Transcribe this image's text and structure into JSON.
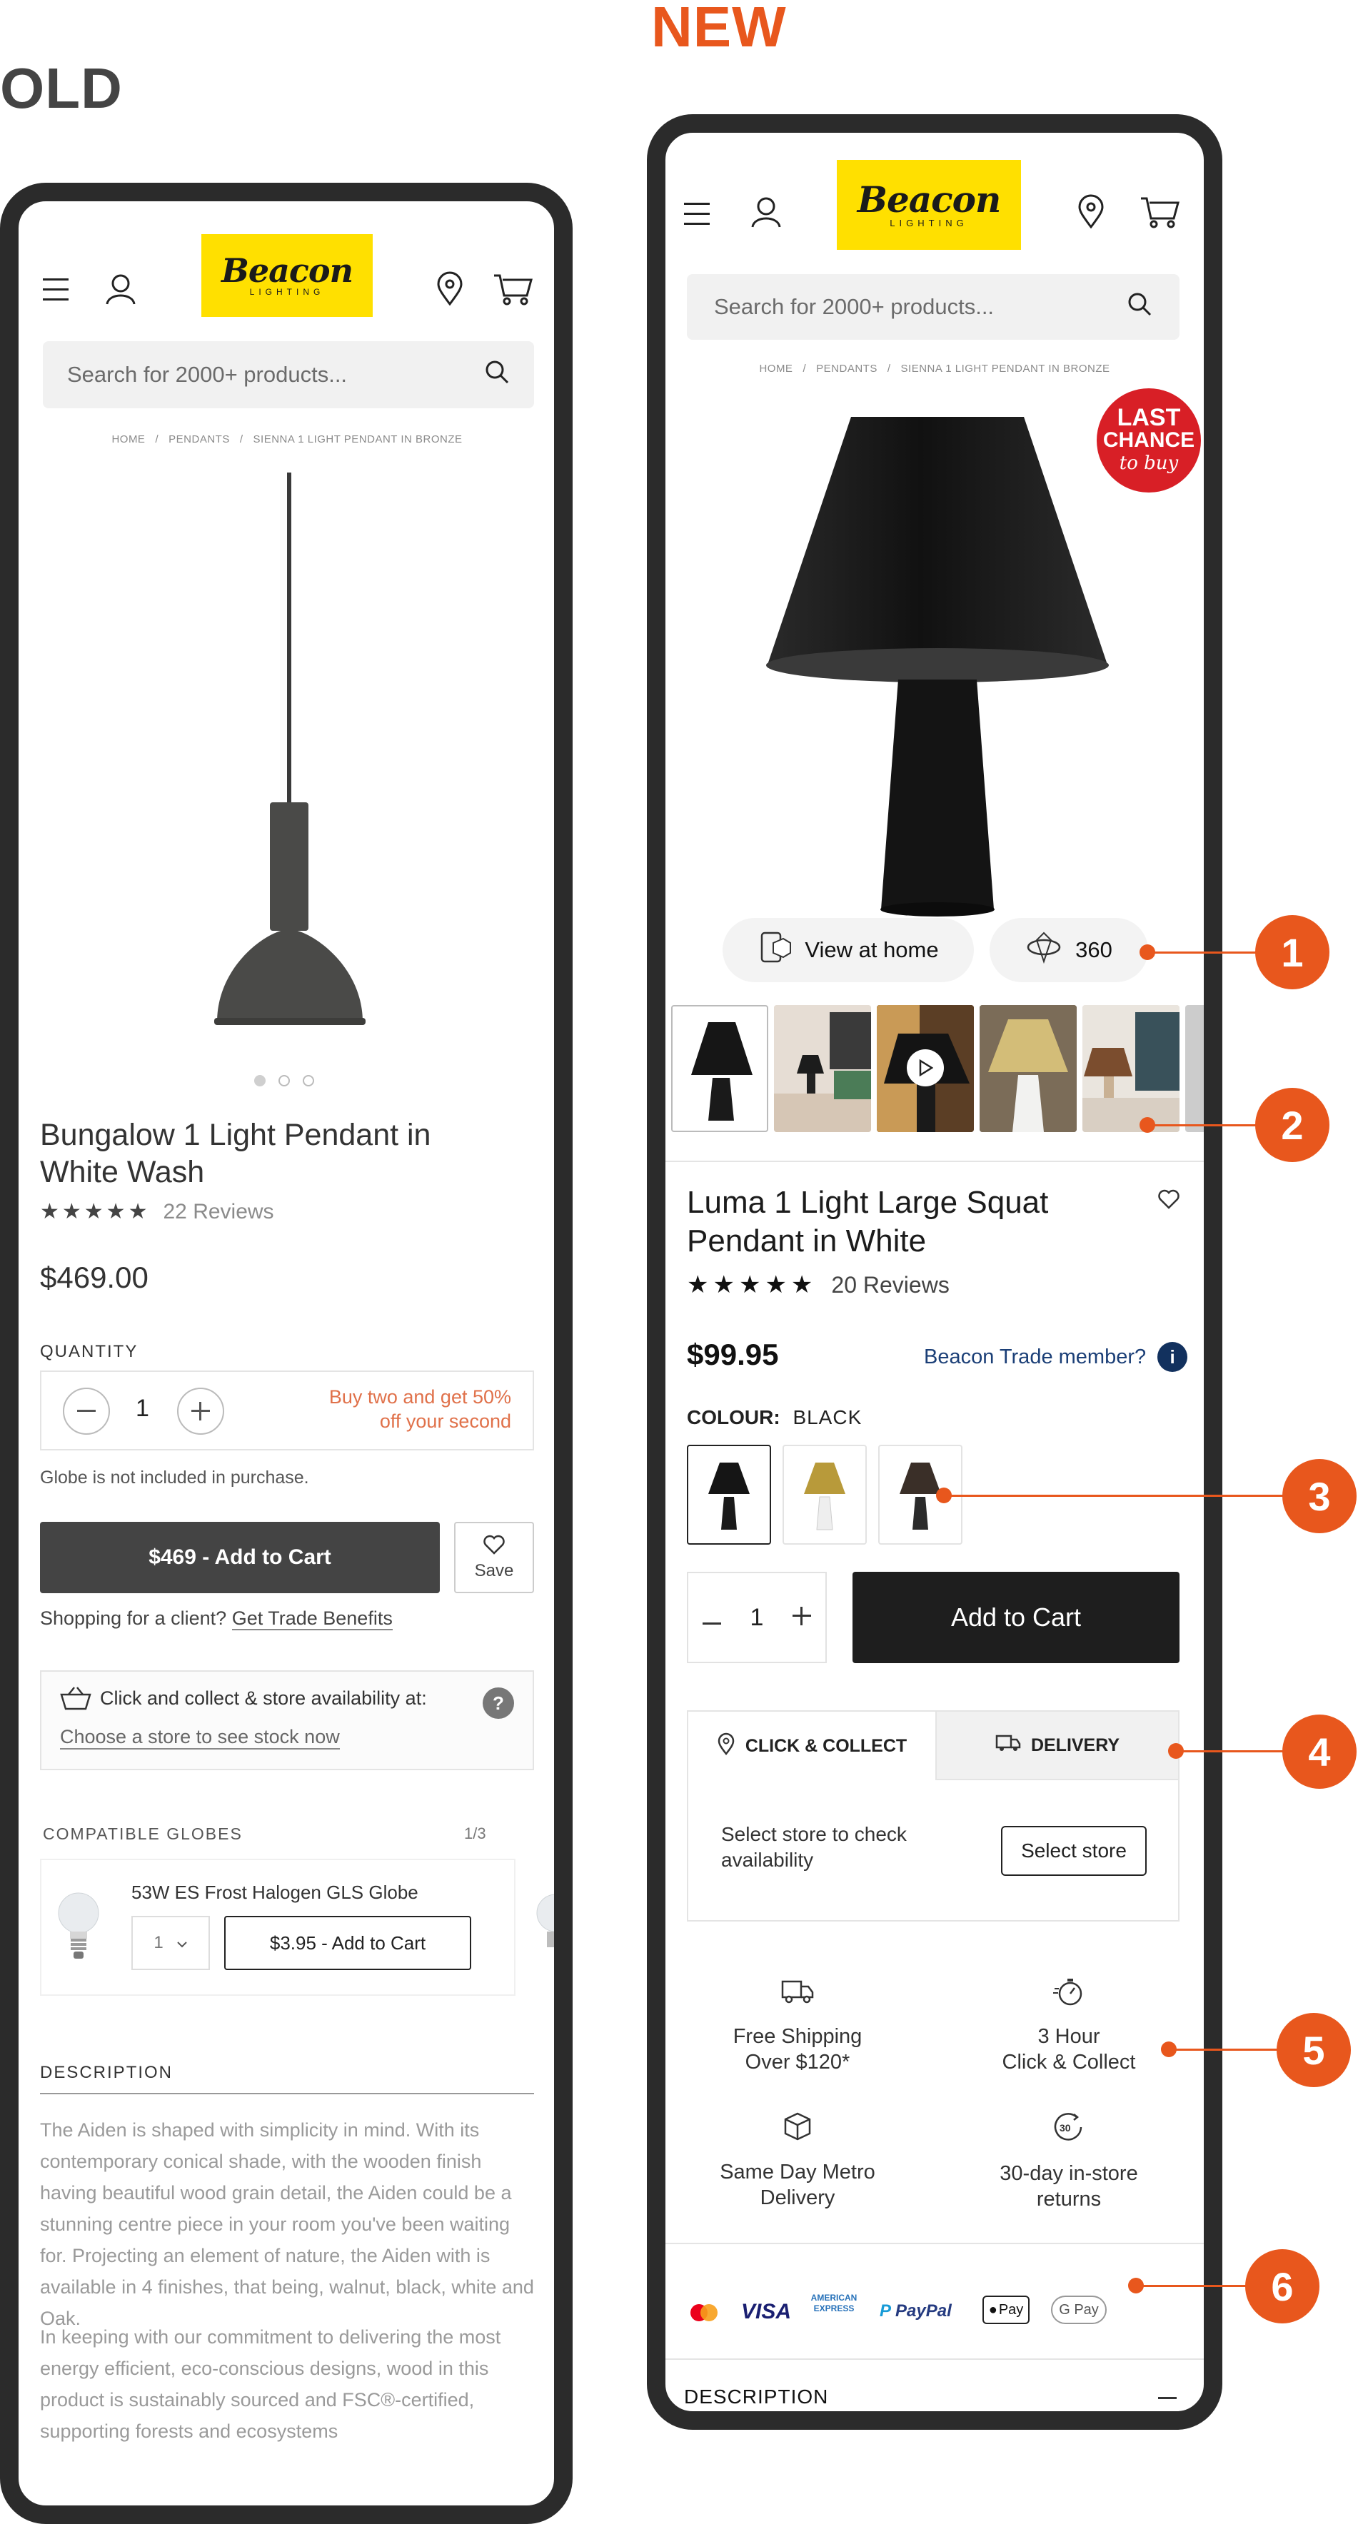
{
  "labels": {
    "old": "OLD",
    "new": "NEW"
  },
  "callouts": [
    "1",
    "2",
    "3",
    "4",
    "5",
    "6"
  ],
  "old": {
    "logo": {
      "script": "Beacon",
      "sub": "LIGHTING"
    },
    "search_placeholder": "Search for 2000+ products...",
    "breadcrumb": {
      "home": "HOME",
      "category": "PENDANTS",
      "current": "SIENNA 1 LIGHT PENDANT IN BRONZE",
      "sep": "/"
    },
    "product_title": "Bungalow 1 Light Pendant in White Wash",
    "stars": "★★★★★",
    "reviews": "22 Reviews",
    "price": "$469.00",
    "quantity_label": "QUANTITY",
    "quantity_value": "1",
    "promo": "Buy two and get 50% off your second",
    "globe_note": "Globe is not included in purchase.",
    "add_to_cart": "$469 - Add to Cart",
    "save": "Save",
    "trade_prefix": "Shopping for a client?",
    "trade_link": "Get Trade Benefits",
    "collect_text": "Click and collect & store availability at:",
    "collect_link": "Choose a store to see stock now",
    "help": "?",
    "compatible_label": "COMPATIBLE GLOBES",
    "compatible_count": "1/3",
    "globe_name": "53W ES Frost Halogen GLS Globe",
    "globe_qty": "1",
    "globe_add": "$3.95 - Add to Cart",
    "description_label": "DESCRIPTION",
    "description_p1": "The Aiden is shaped with simplicity in mind. With its contemporary conical shade, with the wooden finish having beautiful wood grain detail, the Aiden could be a stunning centre piece in your room you've been waiting for. Projecting an element of nature, the Aiden with is available in 4 finishes, that being, walnut, black, white and Oak.",
    "description_p2": "In keeping with our commitment to delivering the most energy efficient, eco-conscious designs, wood in this product is sustainably sourced and FSC®-certified, supporting forests and ecosystems"
  },
  "new": {
    "logo": {
      "script": "Beacon",
      "sub": "LIGHTING"
    },
    "search_placeholder": "Search for 2000+ products...",
    "breadcrumb": {
      "home": "HOME",
      "category": "PENDANTS",
      "current": "SIENNA 1 LIGHT PENDANT IN BRONZE",
      "sep": "/"
    },
    "badge": {
      "line1": "LAST",
      "line2": "CHANCE",
      "line3": "to buy"
    },
    "view_at_home": "View at home",
    "view_360": "360",
    "product_title": "Luma 1 Light Large Squat Pendant in White",
    "stars": "★★★★★",
    "reviews": "20 Reviews",
    "price": "$99.95",
    "trade_member": "Beacon Trade member?",
    "info": "i",
    "colour_label": "COLOUR:",
    "colour_value": "BLACK",
    "quantity_value": "1",
    "add_to_cart": "Add to Cart",
    "tab_collect": "CLICK & COLLECT",
    "tab_delivery": "DELIVERY",
    "store_text": "Select store to check availability",
    "select_store": "Select store",
    "features": [
      {
        "icon": "truck-icon",
        "line1": "Free Shipping",
        "line2": "Over $120*"
      },
      {
        "icon": "stopwatch-icon",
        "line1": "3 Hour",
        "line2": "Click & Collect"
      },
      {
        "icon": "box-icon",
        "line1": "Same Day Metro",
        "line2": "Delivery"
      },
      {
        "icon": "returns-30-icon",
        "line1": "30-day in-store",
        "line2": "returns"
      }
    ],
    "payments": {
      "visa": "VISA",
      "amex1": "AMERICAN",
      "amex2": "EXPRESS",
      "paypal": "PayPal",
      "applepay": "Pay",
      "gpay": "G Pay"
    },
    "description_label": "DESCRIPTION"
  },
  "colors": {
    "accent": "#e8571d",
    "logo_yellow": "#ffe000",
    "badge_red": "#d81f26",
    "dark": "#1e1e1e",
    "link_blue": "#1b3f77"
  }
}
